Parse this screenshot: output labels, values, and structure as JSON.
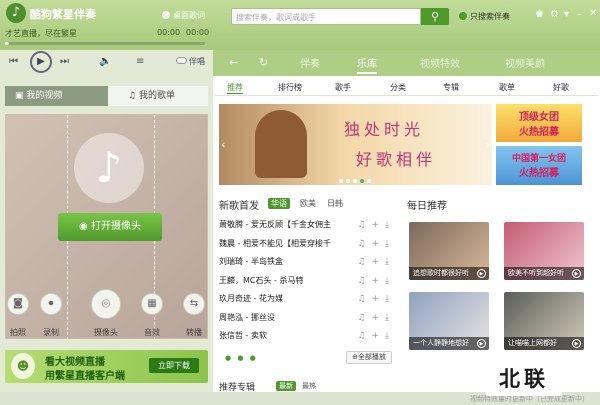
{
  "app": {
    "title": "酷狗繁星伴奏",
    "show_lyrics": "桌面歌词",
    "only_accompaniment": "只搜索伴奏"
  },
  "search": {
    "placeholder": "搜索伴奏，歌词或歌手"
  },
  "player": {
    "song": "才艺直播，尽在繁星",
    "time_left": "00:00",
    "time_right": "00:00",
    "accomp": "伴唱",
    "progress": 0.02
  },
  "main_tabs": [
    {
      "label": "伴奏"
    },
    {
      "label": "乐库"
    },
    {
      "label": "视频特效"
    },
    {
      "label": "视频美颜"
    }
  ],
  "left_tabs": {
    "video": "我的视频",
    "songs": "我的歌单"
  },
  "camera": {
    "open": "打开摄像头"
  },
  "tools": [
    {
      "label": "拍照"
    },
    {
      "label": "录制"
    },
    {
      "label": "摄像头"
    },
    {
      "label": "音效"
    },
    {
      "label": "转播"
    }
  ],
  "ad": {
    "line1": "看大视频直播",
    "line2": "用繁星直播客户端",
    "download": "立即下载"
  },
  "categories": [
    {
      "label": "推荐"
    },
    {
      "label": "排行榜"
    },
    {
      "label": "歌手"
    },
    {
      "label": "分类"
    },
    {
      "label": "专辑"
    },
    {
      "label": "歌单"
    },
    {
      "label": "好歌"
    }
  ],
  "banner": {
    "line1": "独处时光",
    "line2": "好歌相伴"
  },
  "side_banners": [
    {
      "line1": "顶级女团",
      "line2": "火热招募"
    },
    {
      "line1": "中国第一女团",
      "line2": "火热招募"
    }
  ],
  "new_songs": {
    "title": "新歌首发",
    "tabs": [
      {
        "label": "华语"
      },
      {
        "label": "欧美"
      },
      {
        "label": "日韩"
      }
    ]
  },
  "songs": [
    {
      "text": "萧敬腾 - 爱无反顾【千金女佣主"
    },
    {
      "text": "魏晨 - 相爱不能见【相爱穿梭千"
    },
    {
      "text": "刘瑞琦 - 半岛铁盒"
    },
    {
      "text": "王麟，MC石头 - 杀马特"
    },
    {
      "text": "玖月奇迹 - 花为媒"
    },
    {
      "text": "周艳泓 - 挪丝没"
    },
    {
      "text": "张信哲 - 卖软"
    }
  ],
  "play_all": "全部播放",
  "daily": {
    "title": "每日推荐",
    "items": [
      {
        "caption": "追想歌时都很好听"
      },
      {
        "caption": "欧美不听到超好听"
      },
      {
        "caption": "一个人静静地想好"
      },
      {
        "caption": "让喵喵上网都好"
      }
    ]
  },
  "albums": {
    "title": "推荐专辑",
    "tabs": [
      {
        "label": "最新"
      },
      {
        "label": "最热"
      }
    ]
  },
  "footer": {
    "text": "视频特效量时更新中（已完成更新中）"
  },
  "watermark": "北联",
  "colors": {
    "accent": "#4e9a2b",
    "pink": "#e0448a"
  }
}
